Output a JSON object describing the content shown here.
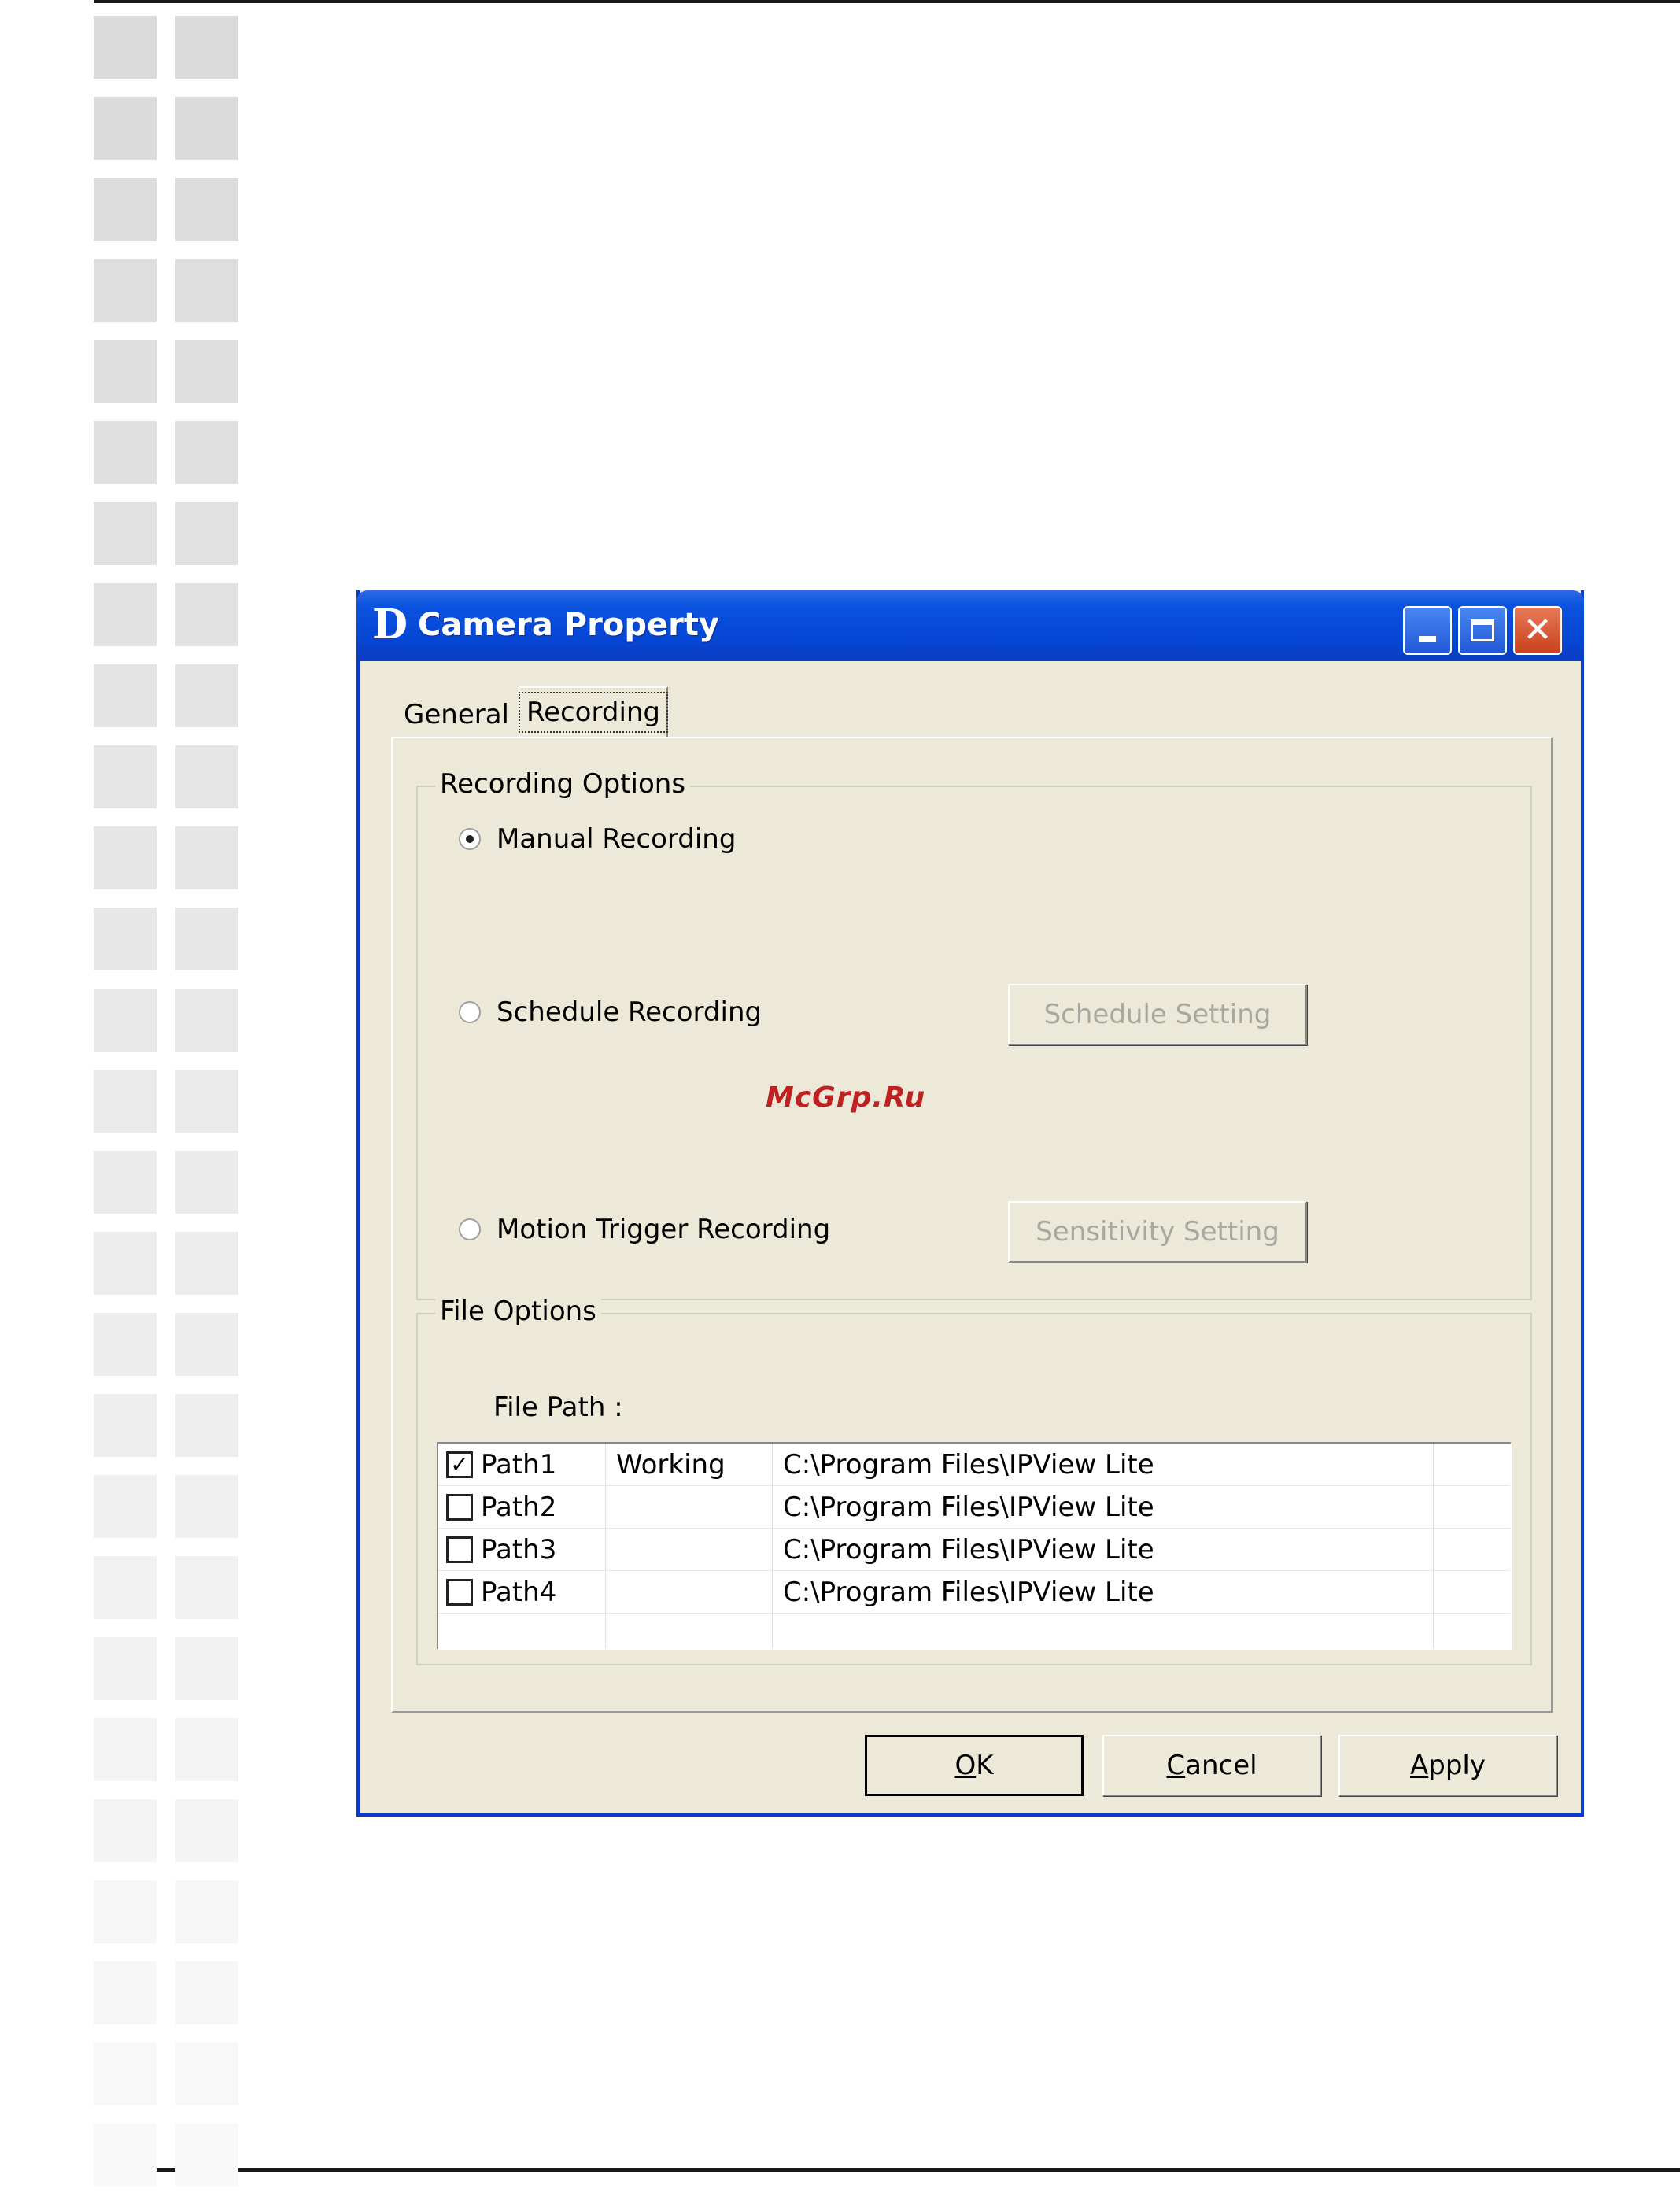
{
  "window": {
    "title": "Camera Property",
    "app_icon_letter": "D"
  },
  "tabs": [
    {
      "label": "General",
      "active": false
    },
    {
      "label": "Recording",
      "active": true
    }
  ],
  "recording_options": {
    "legend": "Recording Options",
    "manual": {
      "label": "Manual Recording",
      "selected": true
    },
    "schedule": {
      "label": "Schedule Recording",
      "selected": false,
      "button": "Schedule Setting"
    },
    "motion": {
      "label": "Motion Trigger Recording",
      "selected": false,
      "button": "Sensitivity Setting"
    }
  },
  "file_options": {
    "legend": "File Options",
    "file_path_label": "File Path  :",
    "rows": [
      {
        "name": "Path1",
        "checked": true,
        "status": "Working",
        "path": "C:\\Program Files\\IPView Lite"
      },
      {
        "name": "Path2",
        "checked": false,
        "status": "",
        "path": "C:\\Program Files\\IPView Lite"
      },
      {
        "name": "Path3",
        "checked": false,
        "status": "",
        "path": "C:\\Program Files\\IPView Lite"
      },
      {
        "name": "Path4",
        "checked": false,
        "status": "",
        "path": "C:\\Program Files\\IPView Lite"
      }
    ]
  },
  "buttons": {
    "ok": {
      "pre": "",
      "key": "O",
      "post": "K"
    },
    "cancel": {
      "pre": "",
      "key": "C",
      "post": "ancel"
    },
    "apply": {
      "pre": "",
      "key": "A",
      "post": "pply"
    }
  },
  "watermark": "McGrp.Ru",
  "colors": {
    "titlebar": "#0646d4",
    "window_bg": "#ece9d8",
    "close_button": "#c8411c",
    "watermark": "#c02020"
  }
}
